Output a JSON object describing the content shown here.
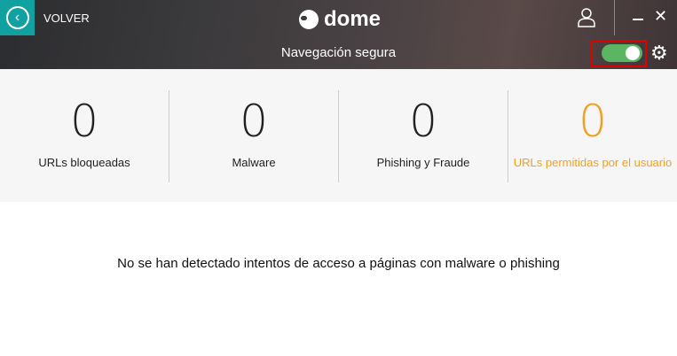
{
  "header": {
    "back_label": "VOLVER",
    "logo_text": "dome",
    "logo_small": "panda",
    "title": "Navegación segura",
    "toggle_on": true,
    "toggle_color": "#5cb562",
    "accent": "#11a1a0"
  },
  "stats": [
    {
      "value": "0",
      "label": "URLs bloqueadas"
    },
    {
      "value": "0",
      "label": "Malware"
    },
    {
      "value": "0",
      "label": "Phishing y Fraude"
    },
    {
      "value": "0",
      "label": "URLs permitidas por el usuario",
      "color": "#f0a020"
    }
  ],
  "message": "No se han detectado intentos de acceso a páginas con malware o phishing"
}
